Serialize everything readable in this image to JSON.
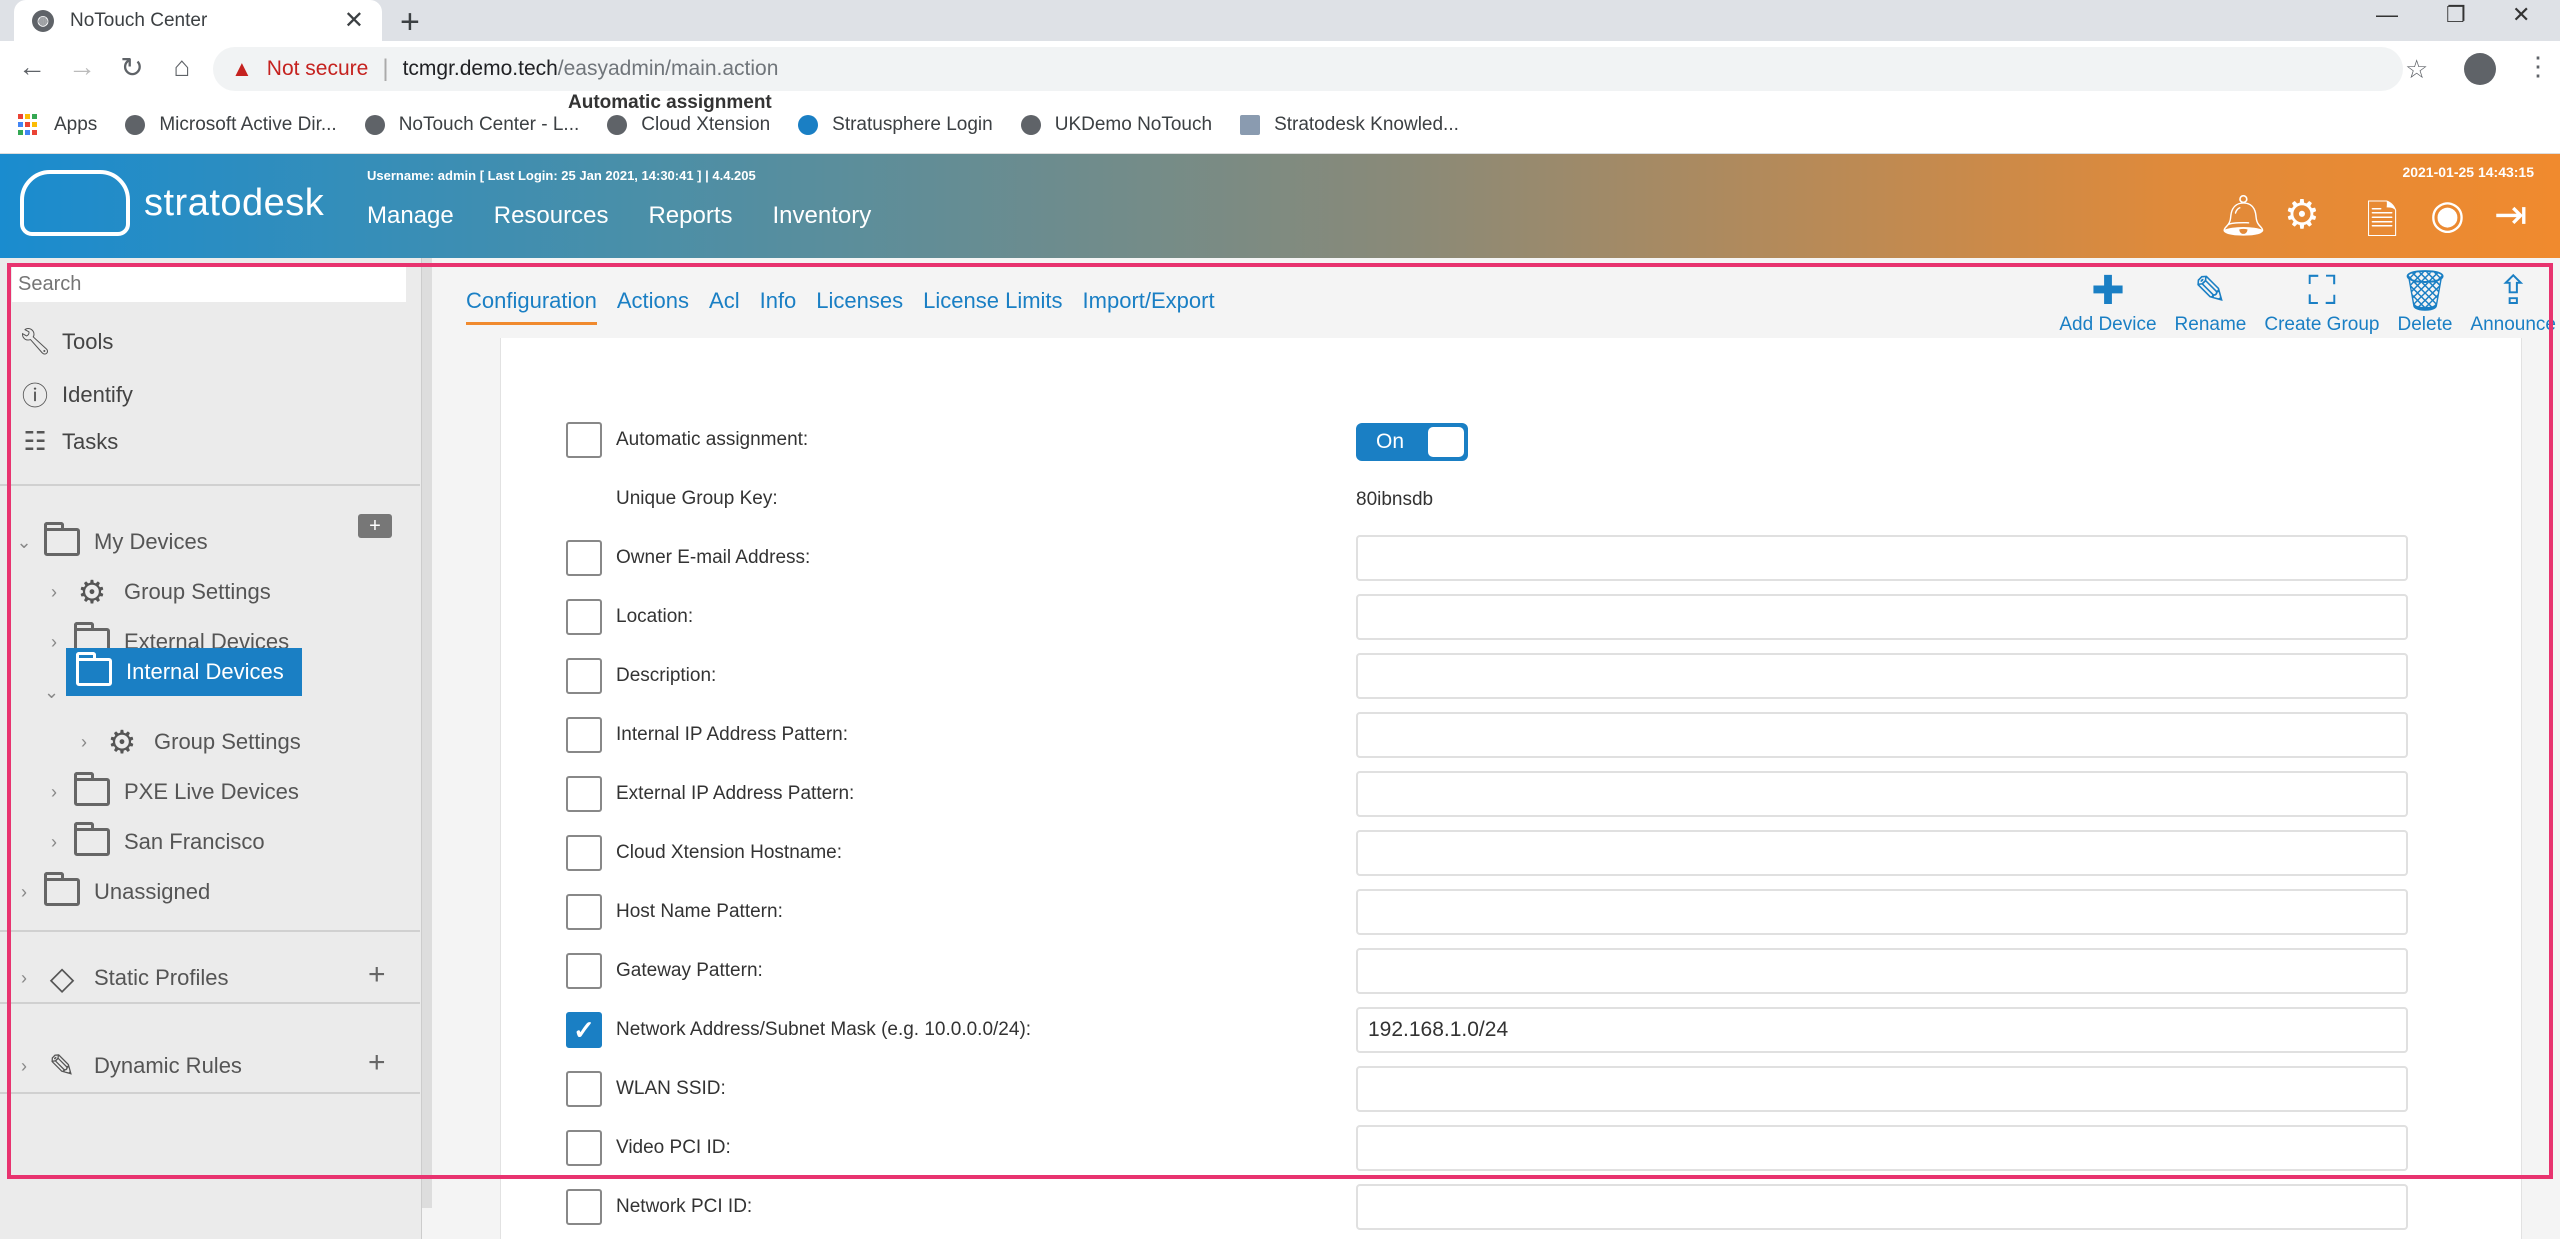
{
  "browser": {
    "tab_title": "NoTouch Center",
    "tab_close": "✕",
    "new_tab": "+",
    "security_label": "Not secure",
    "url_host": "tcmgr.demo.tech",
    "url_path": "/easyadmin/main.action",
    "bookmarks": [
      {
        "label": "Apps",
        "icon": "apps-grid-icon"
      },
      {
        "label": "Microsoft Active Dir...",
        "icon": "globe-icon"
      },
      {
        "label": "NoTouch Center - L...",
        "icon": "globe-icon"
      },
      {
        "label": "Cloud Xtension",
        "icon": "globe-icon"
      },
      {
        "label": "Stratusphere Login",
        "icon": "stratusphere-icon"
      },
      {
        "label": "UKDemo NoTouch",
        "icon": "globe-icon"
      },
      {
        "label": "Stratodesk Knowled...",
        "icon": "doc-icon"
      }
    ]
  },
  "header": {
    "logo_text": "stratodesk",
    "user_info": "Username: admin [ Last Login: 25 Jan 2021, 14:30:41 ]  |  4.4.205",
    "datetime": "2021-01-25 14:43:15",
    "nav": [
      "Manage",
      "Resources",
      "Reports",
      "Inventory"
    ]
  },
  "sidebar": {
    "search_placeholder": "Search",
    "tools": [
      "Tools",
      "Identify",
      "Tasks"
    ],
    "tree": [
      {
        "label": "My Devices"
      },
      {
        "label": "Group Settings"
      },
      {
        "label": "External Devices"
      },
      {
        "label": "Internal Devices"
      },
      {
        "label": "Group Settings"
      },
      {
        "label": "PXE Live Devices"
      },
      {
        "label": "San Francisco"
      },
      {
        "label": "Unassigned"
      }
    ],
    "sections": [
      "Static Profiles",
      "Dynamic Rules"
    ]
  },
  "main": {
    "tabs": [
      "Configuration",
      "Actions",
      "Acl",
      "Info",
      "Licenses",
      "License Limits",
      "Import/Export"
    ],
    "actions": [
      "Add Device",
      "Rename",
      "Create Group",
      "Delete",
      "Announce"
    ],
    "panel_title": "Automatic assignment",
    "toggle_label": "On",
    "fields": [
      {
        "label": "Automatic assignment:",
        "checked": false
      },
      {
        "label": "Unique Group Key:",
        "value": "80ibnsdb"
      },
      {
        "label": "Owner E-mail Address:",
        "checked": false,
        "value": ""
      },
      {
        "label": "Location:",
        "checked": false,
        "value": ""
      },
      {
        "label": "Description:",
        "checked": false,
        "value": ""
      },
      {
        "label": "Internal IP Address Pattern:",
        "checked": false,
        "value": ""
      },
      {
        "label": "External IP Address Pattern:",
        "checked": false,
        "value": ""
      },
      {
        "label": "Cloud Xtension Hostname:",
        "checked": false,
        "value": ""
      },
      {
        "label": "Host Name Pattern:",
        "checked": false,
        "value": ""
      },
      {
        "label": "Gateway Pattern:",
        "checked": false,
        "value": ""
      },
      {
        "label": "Network Address/Subnet Mask (e.g. 10.0.0.0/24):",
        "checked": true,
        "value": "192.168.1.0/24"
      },
      {
        "label": "WLAN SSID:",
        "checked": false,
        "value": ""
      },
      {
        "label": "Video PCI ID:",
        "checked": false,
        "value": ""
      },
      {
        "label": "Network PCI ID:",
        "checked": false,
        "value": ""
      }
    ]
  },
  "colors": {
    "accent_blue": "#1a7fc4",
    "accent_orange": "#f08a2e",
    "highlight": "#e8336f"
  }
}
